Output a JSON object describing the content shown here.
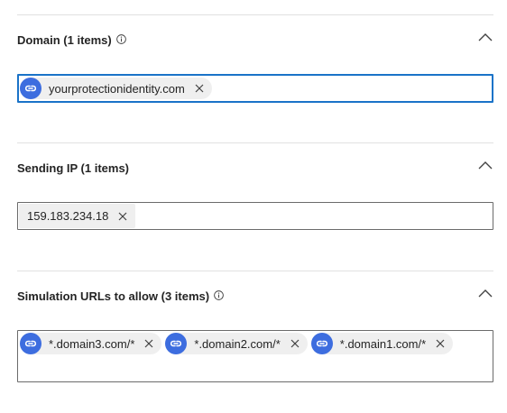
{
  "domain_section": {
    "title": "Domain (1 items)",
    "info_icon": "info-icon",
    "chips": [
      {
        "label": "yourprotectionidentity.com",
        "icon": "link-icon"
      }
    ]
  },
  "sending_ip_section": {
    "title": "Sending IP (1 items)",
    "chips": [
      {
        "label": "159.183.234.18"
      }
    ]
  },
  "simulation_urls_section": {
    "title": "Simulation URLs to allow (3 items)",
    "info_icon": "info-icon",
    "chips": [
      {
        "label": "*.domain3.com/*",
        "icon": "link-icon"
      },
      {
        "label": "*.domain2.com/*",
        "icon": "link-icon"
      },
      {
        "label": "*.domain1.com/*",
        "icon": "link-icon"
      }
    ]
  },
  "colors": {
    "chip_avatar": "#3d6ddf",
    "focus_border": "#1a73c8",
    "chip_background": "#efefef"
  }
}
